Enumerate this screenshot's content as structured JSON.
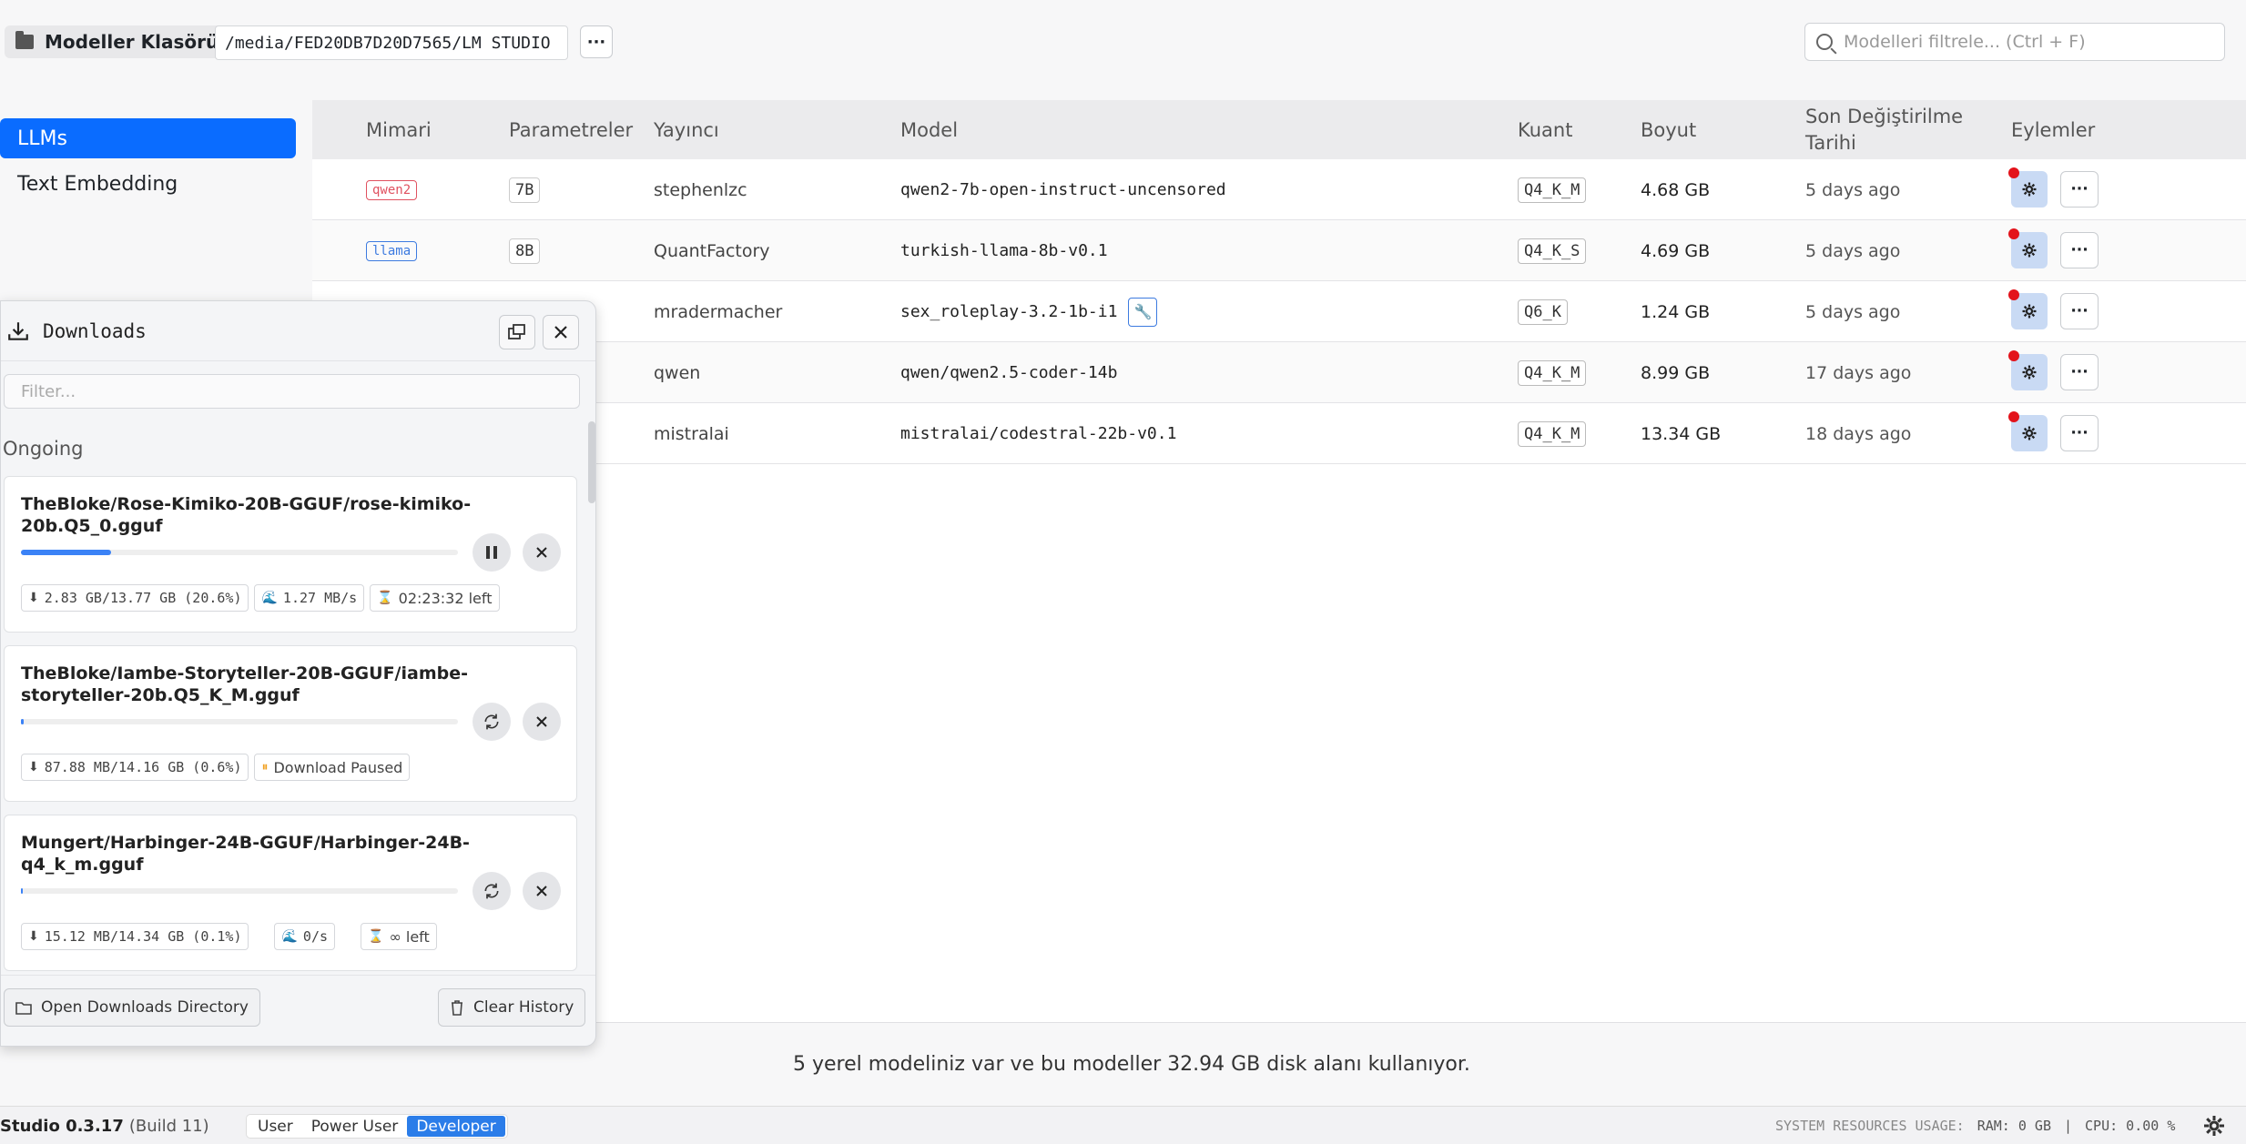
{
  "topbar": {
    "folder_label": "Modeller Klasörü",
    "folder_path": "/media/FED20DB7D20D7565/LM STUDIO",
    "more_label": "···",
    "filter_placeholder": "Modelleri filtrele... (Ctrl + F)"
  },
  "sidebar": {
    "items": [
      {
        "label": "LLMs",
        "active": true
      },
      {
        "label": "Text Embedding",
        "active": false
      }
    ]
  },
  "table": {
    "headers": {
      "arch": "Mimari",
      "params": "Parametreler",
      "publisher": "Yayıncı",
      "model": "Model",
      "quant": "Kuant",
      "size": "Boyut",
      "modified_1": "Son Değiştirilme",
      "modified_2": "Tarihi",
      "actions": "Eylemler"
    },
    "rows": [
      {
        "arch": "qwen2",
        "arch_color": "#e05260",
        "params": "7B",
        "publisher": "stephenlzc",
        "model": "qwen2-7b-open-instruct-uncensored",
        "quant": "Q4_K_M",
        "size": "4.68 GB",
        "modified": "5 days ago"
      },
      {
        "arch": "llama",
        "arch_color": "#3d7be0",
        "params": "8B",
        "publisher": "QuantFactory",
        "model": "turkish-llama-8b-v0.1",
        "quant": "Q4_K_S",
        "size": "4.69 GB",
        "modified": "5 days ago"
      },
      {
        "arch": "",
        "arch_color": "#888888",
        "params": "",
        "publisher": "mradermacher",
        "model": "sex_roleplay-3.2-1b-i1",
        "quant": "Q6_K",
        "size": "1.24 GB",
        "modified": "5 days ago"
      },
      {
        "arch": "",
        "arch_color": "#888888",
        "params": "",
        "publisher": "qwen",
        "model": "qwen/qwen2.5-coder-14b",
        "quant": "Q4_K_M",
        "size": "8.99 GB",
        "modified": "17 days ago"
      },
      {
        "arch": "",
        "arch_color": "#888888",
        "params": "",
        "publisher": "mistralai",
        "model": "mistralai/codestral-22b-v0.1",
        "quant": "Q4_K_M",
        "size": "13.34 GB",
        "modified": "18 days ago"
      }
    ]
  },
  "summary": "5 yerel modeliniz var ve bu modeller 32.94 GB disk alanı kullanıyor.",
  "statusbar": {
    "app_name": "Studio 0.3.17",
    "build": "(Build 11)",
    "modes": [
      "User",
      "Power User",
      "Developer"
    ],
    "active_mode": "Developer",
    "sys_label": "SYSTEM RESOURCES USAGE:",
    "ram": "RAM: 0 GB",
    "sep": "|",
    "cpu": "CPU: 0.00 %"
  },
  "downloads": {
    "title": "Downloads",
    "filter_placeholder": "Filter...",
    "section": "Ongoing",
    "items": [
      {
        "name": "TheBloke/Rose-Kimiko-20B-GGUF/rose-kimiko-20b.Q5_0.gguf",
        "progress": 0.206,
        "size": "2.83 GB/13.77 GB (20.6%)",
        "speed": "1.27 MB/s",
        "eta": "02:23:32 left",
        "state": "downloading"
      },
      {
        "name": "TheBloke/Iambe-Storyteller-20B-GGUF/iambe-storyteller-20b.Q5_K_M.gguf",
        "progress": 0.006,
        "size": "87.88 MB/14.16 GB (0.6%)",
        "status": "Download Paused",
        "state": "paused"
      },
      {
        "name": "Mungert/Harbinger-24B-GGUF/Harbinger-24B-q4_k_m.gguf",
        "progress": 0.001,
        "size": "15.12 MB/14.34 GB (0.1%)",
        "speed": "0/s",
        "eta": "∞ left",
        "state": "stalled"
      }
    ],
    "open_dir_label": "Open Downloads Directory",
    "clear_label": "Clear History"
  },
  "colors": {
    "accent": "#0a6cff",
    "progress": "#3b82f6",
    "notify_dot": "#e3131b"
  }
}
